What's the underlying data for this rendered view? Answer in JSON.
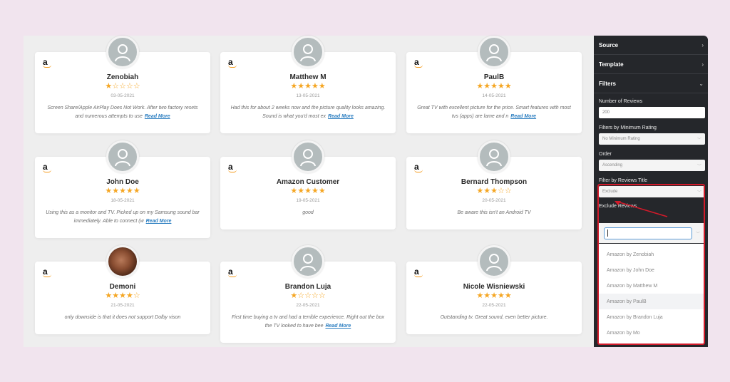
{
  "reviews": [
    {
      "name": "Zenobiah",
      "rating": 1,
      "stars": "★☆☆☆☆",
      "date": "03-05-2021",
      "text": "Screen Share/Apple AirPlay Does Not Work. After two factory resets and numerous attempts to use",
      "read_more": "Read More",
      "avatar": "default"
    },
    {
      "name": "Matthew M",
      "rating": 5,
      "stars": "★★★★★",
      "date": "13-05-2021",
      "text": "Had this for about 2 weeks now and the picture quality looks amazing. Sound is what you'd most ex",
      "read_more": "Read More",
      "avatar": "default"
    },
    {
      "name": "PaulB",
      "rating": 5,
      "stars": "★★★★★",
      "date": "14-05-2021",
      "text": "Great TV with excellent picture for the price. Smart features with most tvs (apps) are lame and n",
      "read_more": "Read More",
      "avatar": "default"
    },
    {
      "name": "John Doe",
      "rating": 5,
      "stars": "★★★★★",
      "date": "18-05-2021",
      "text": "Using this as a monitor and TV. Picked up on my Samsung sound bar immediately. Able to connect (w",
      "read_more": "Read More",
      "avatar": "default"
    },
    {
      "name": "Amazon Customer",
      "rating": 5,
      "stars": "★★★★★",
      "date": "19-05-2021",
      "text": "good",
      "read_more": null,
      "avatar": "default"
    },
    {
      "name": "Bernard Thompson",
      "rating": 3,
      "stars": "★★★☆☆",
      "date": "20-05-2021",
      "text": "Be aware this isn't an Android TV",
      "read_more": null,
      "avatar": "default"
    },
    {
      "name": "Demoni",
      "rating": 4,
      "stars": "★★★★☆",
      "date": "21-05-2021",
      "text": "only downside is that it does not support Dolby vison",
      "read_more": null,
      "avatar": "photo"
    },
    {
      "name": "Brandon Luja",
      "rating": 1,
      "stars": "★☆☆☆☆",
      "date": "22-05-2021",
      "text": "First time buying a tv and had a terrible experience. Right out the box the TV looked to have bee",
      "read_more": "Read More",
      "avatar": "default"
    },
    {
      "name": "Nicole Wisniewski",
      "rating": 5,
      "stars": "★★★★★",
      "date": "22-05-2021",
      "text": "Outstanding tv. Great sound, even better picture.",
      "read_more": null,
      "avatar": "default"
    }
  ],
  "sidebar": {
    "sections": [
      {
        "label": "Source",
        "chevron": "›"
      },
      {
        "label": "Template",
        "chevron": "›"
      },
      {
        "label": "Filters",
        "chevron": "⌄"
      }
    ],
    "filters": {
      "number_of_reviews_label": "Number of Reviews",
      "number_of_reviews_value": "200",
      "min_rating_label": "Filters by Minimum Rating",
      "min_rating_value": "No Minimum Rating",
      "order_label": "Order",
      "order_value": "Ascending",
      "title_filter_label": "Filter by Reviews Title",
      "title_filter_value": "Exclude",
      "exclude_label": "Exclude Reviews",
      "exclude_value": "",
      "exclude_options": [
        "Amazon by Zenobiah",
        "Amazon by John Doe",
        "Amazon by Matthew M",
        "Amazon by PaulB",
        "Amazon by Brandon Luja",
        "Amazon by Mo"
      ],
      "hovered_option_index": 3
    }
  },
  "colors": {
    "star": "#f5a623",
    "read_more": "#2d7fc1",
    "highlight": "#d21a2a",
    "sidebar_bg": "#25272b"
  }
}
